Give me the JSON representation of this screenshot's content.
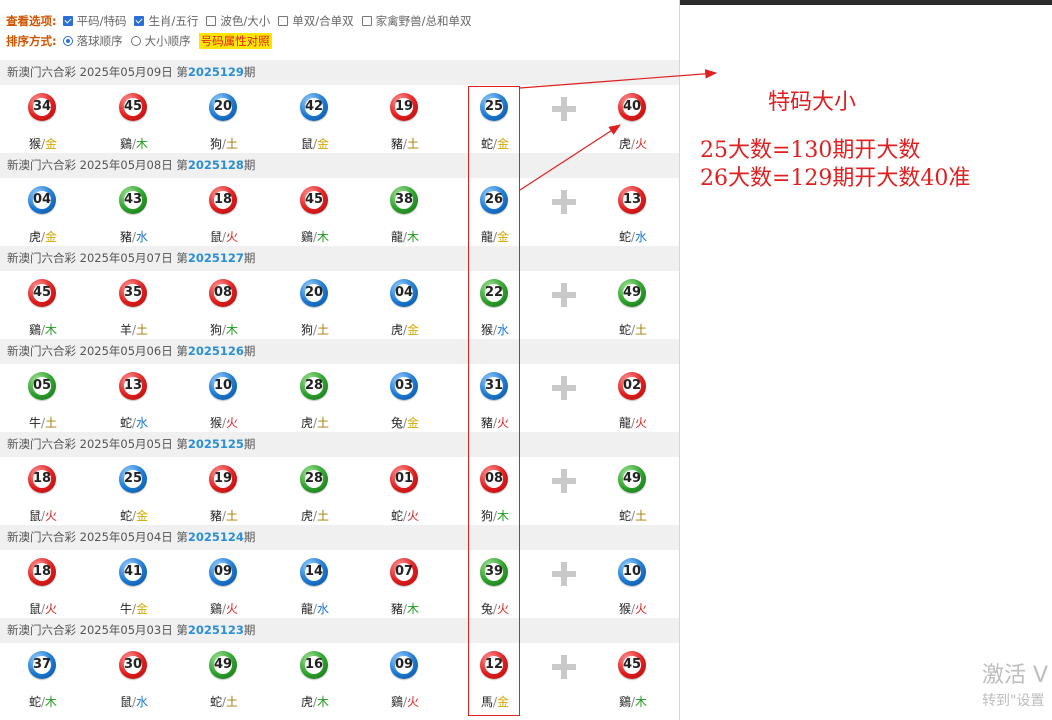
{
  "filters": {
    "view_label": "查看选项:",
    "view_options": [
      {
        "label": "平码/特码",
        "checked": true
      },
      {
        "label": "生肖/五行",
        "checked": true
      },
      {
        "label": "波色/大小",
        "checked": false
      },
      {
        "label": "单双/合单双",
        "checked": false
      },
      {
        "label": "家禽野兽/总和单双",
        "checked": false
      }
    ],
    "sort_label": "排序方式:",
    "sort_options": [
      {
        "label": "落球顺序",
        "selected": true
      },
      {
        "label": "大小顺序",
        "selected": false
      }
    ],
    "highlight_link": "号码属性对照"
  },
  "draws": [
    {
      "prefix": "新澳门六合彩 2025年05月09日 第",
      "period": "2025129",
      "suffix": "期",
      "balls": [
        {
          "n": "34",
          "c": "red",
          "z": "猴",
          "e": "金"
        },
        {
          "n": "45",
          "c": "red",
          "z": "鷄",
          "e": "木"
        },
        {
          "n": "20",
          "c": "blue",
          "z": "狗",
          "e": "土"
        },
        {
          "n": "42",
          "c": "blue",
          "z": "鼠",
          "e": "金"
        },
        {
          "n": "19",
          "c": "red",
          "z": "豬",
          "e": "土"
        },
        {
          "n": "25",
          "c": "blue",
          "z": "蛇",
          "e": "金"
        },
        {
          "n": "40",
          "c": "red",
          "z": "虎",
          "e": "火"
        }
      ]
    },
    {
      "prefix": "新澳门六合彩 2025年05月08日 第",
      "period": "2025128",
      "suffix": "期",
      "balls": [
        {
          "n": "04",
          "c": "blue",
          "z": "虎",
          "e": "金"
        },
        {
          "n": "43",
          "c": "green",
          "z": "豬",
          "e": "水"
        },
        {
          "n": "18",
          "c": "red",
          "z": "鼠",
          "e": "火"
        },
        {
          "n": "45",
          "c": "red",
          "z": "鷄",
          "e": "木"
        },
        {
          "n": "38",
          "c": "green",
          "z": "龍",
          "e": "木"
        },
        {
          "n": "26",
          "c": "blue",
          "z": "龍",
          "e": "金"
        },
        {
          "n": "13",
          "c": "red",
          "z": "蛇",
          "e": "水"
        }
      ]
    },
    {
      "prefix": "新澳门六合彩 2025年05月07日 第",
      "period": "2025127",
      "suffix": "期",
      "balls": [
        {
          "n": "45",
          "c": "red",
          "z": "鷄",
          "e": "木"
        },
        {
          "n": "35",
          "c": "red",
          "z": "羊",
          "e": "土"
        },
        {
          "n": "08",
          "c": "red",
          "z": "狗",
          "e": "木"
        },
        {
          "n": "20",
          "c": "blue",
          "z": "狗",
          "e": "土"
        },
        {
          "n": "04",
          "c": "blue",
          "z": "虎",
          "e": "金"
        },
        {
          "n": "22",
          "c": "green",
          "z": "猴",
          "e": "水"
        },
        {
          "n": "49",
          "c": "green",
          "z": "蛇",
          "e": "土"
        }
      ]
    },
    {
      "prefix": "新澳门六合彩 2025年05月06日 第",
      "period": "2025126",
      "suffix": "期",
      "balls": [
        {
          "n": "05",
          "c": "green",
          "z": "牛",
          "e": "土"
        },
        {
          "n": "13",
          "c": "red",
          "z": "蛇",
          "e": "水"
        },
        {
          "n": "10",
          "c": "blue",
          "z": "猴",
          "e": "火"
        },
        {
          "n": "28",
          "c": "green",
          "z": "虎",
          "e": "土"
        },
        {
          "n": "03",
          "c": "blue",
          "z": "兔",
          "e": "金"
        },
        {
          "n": "31",
          "c": "blue",
          "z": "豬",
          "e": "火"
        },
        {
          "n": "02",
          "c": "red",
          "z": "龍",
          "e": "火"
        }
      ]
    },
    {
      "prefix": "新澳门六合彩 2025年05月05日 第",
      "period": "2025125",
      "suffix": "期",
      "balls": [
        {
          "n": "18",
          "c": "red",
          "z": "鼠",
          "e": "火"
        },
        {
          "n": "25",
          "c": "blue",
          "z": "蛇",
          "e": "金"
        },
        {
          "n": "19",
          "c": "red",
          "z": "豬",
          "e": "土"
        },
        {
          "n": "28",
          "c": "green",
          "z": "虎",
          "e": "土"
        },
        {
          "n": "01",
          "c": "red",
          "z": "蛇",
          "e": "火"
        },
        {
          "n": "08",
          "c": "red",
          "z": "狗",
          "e": "木"
        },
        {
          "n": "49",
          "c": "green",
          "z": "蛇",
          "e": "土"
        }
      ]
    },
    {
      "prefix": "新澳门六合彩 2025年05月04日 第",
      "period": "2025124",
      "suffix": "期",
      "balls": [
        {
          "n": "18",
          "c": "red",
          "z": "鼠",
          "e": "火"
        },
        {
          "n": "41",
          "c": "blue",
          "z": "牛",
          "e": "金"
        },
        {
          "n": "09",
          "c": "blue",
          "z": "鷄",
          "e": "火"
        },
        {
          "n": "14",
          "c": "blue",
          "z": "龍",
          "e": "水"
        },
        {
          "n": "07",
          "c": "red",
          "z": "豬",
          "e": "木"
        },
        {
          "n": "39",
          "c": "green",
          "z": "兔",
          "e": "火"
        },
        {
          "n": "10",
          "c": "blue",
          "z": "猴",
          "e": "火"
        }
      ]
    },
    {
      "prefix": "新澳门六合彩 2025年05月03日 第",
      "period": "2025123",
      "suffix": "期",
      "balls": [
        {
          "n": "37",
          "c": "blue",
          "z": "蛇",
          "e": "木"
        },
        {
          "n": "30",
          "c": "red",
          "z": "鼠",
          "e": "水"
        },
        {
          "n": "49",
          "c": "green",
          "z": "蛇",
          "e": "土"
        },
        {
          "n": "16",
          "c": "green",
          "z": "虎",
          "e": "木"
        },
        {
          "n": "09",
          "c": "blue",
          "z": "鷄",
          "e": "火"
        },
        {
          "n": "12",
          "c": "red",
          "z": "馬",
          "e": "金"
        },
        {
          "n": "45",
          "c": "red",
          "z": "鷄",
          "e": "木"
        }
      ]
    }
  ],
  "annotation": {
    "title": "特码大小",
    "lines": [
      "25大数=130期开大数",
      "26大数=129期开大数40准"
    ],
    "color": "#e02020"
  },
  "watermark": {
    "line1": "激活 V",
    "line2": "转到\"设置"
  },
  "colors": {
    "red": "#e11c1c",
    "blue": "#1a78d2",
    "green": "#2aa02a",
    "period": "#2a8fd4",
    "highlight": "#ffe600"
  }
}
